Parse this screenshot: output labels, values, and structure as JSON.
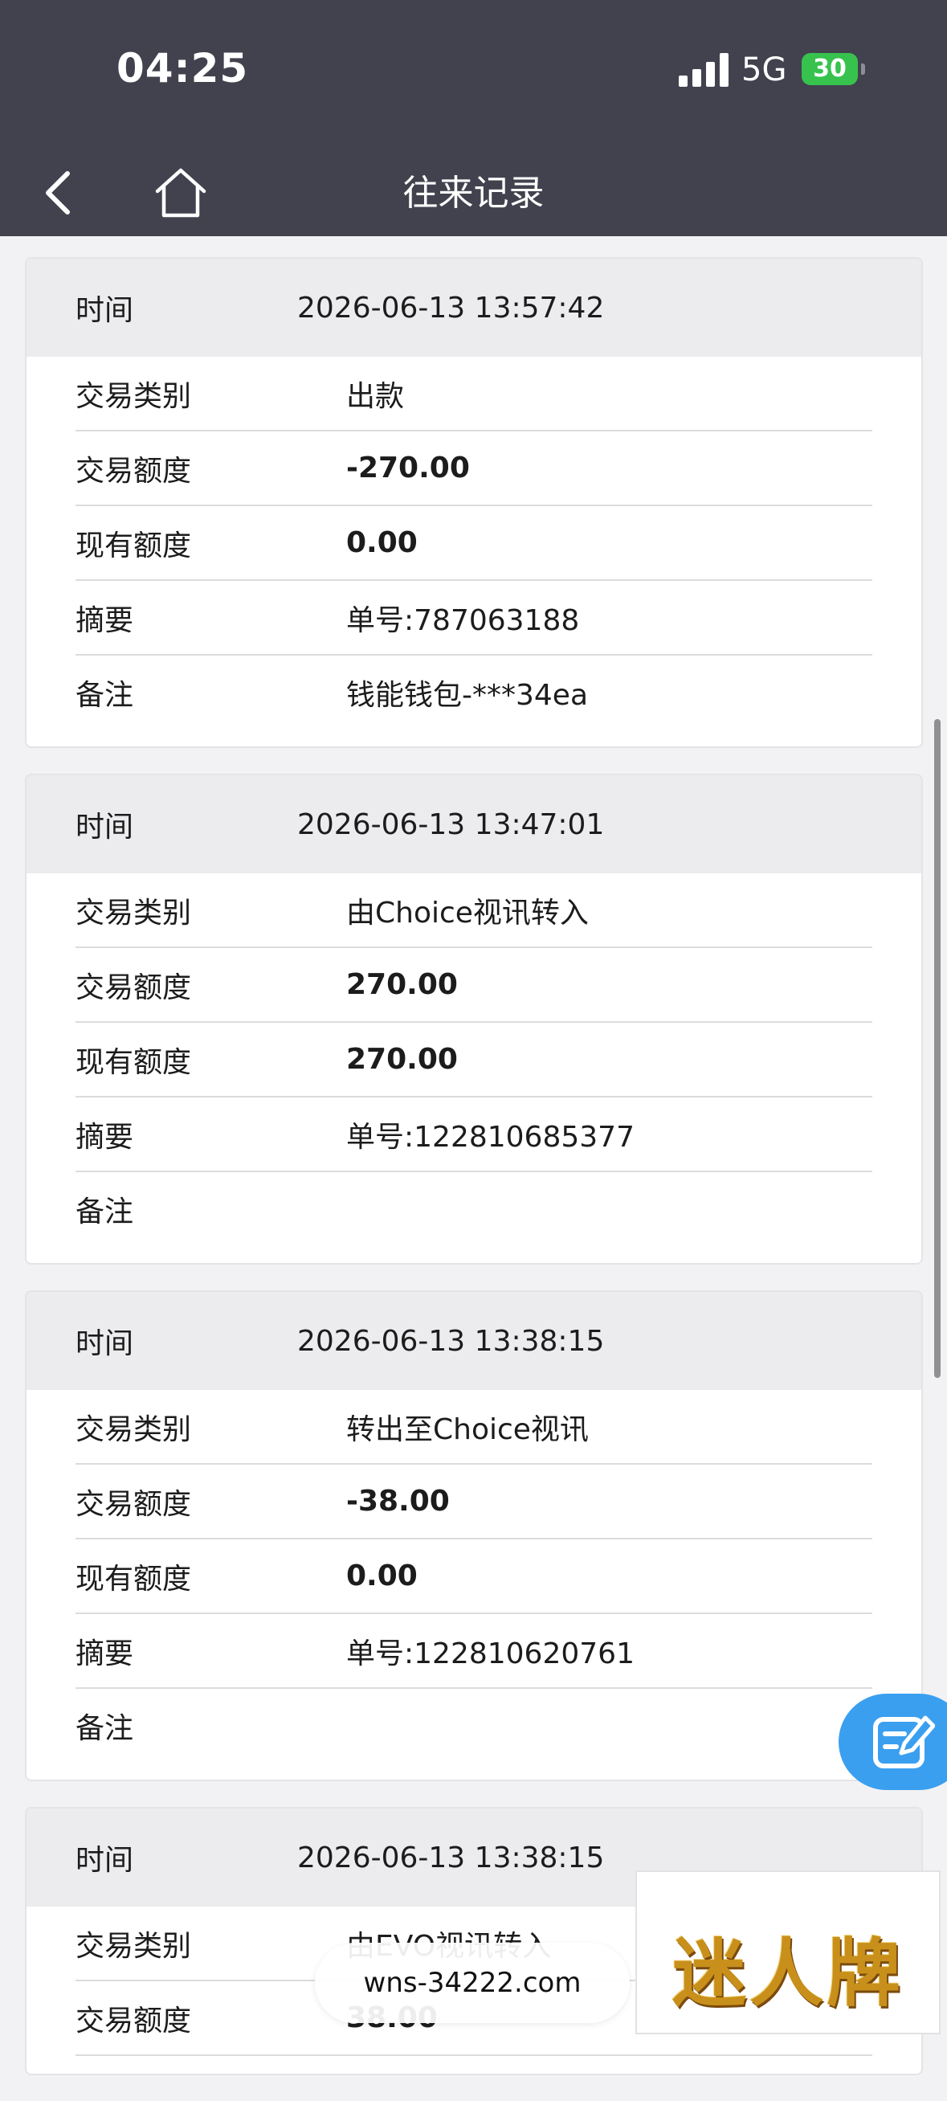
{
  "status_bar": {
    "time": "04:25",
    "network": "5G",
    "battery": "30"
  },
  "nav": {
    "back_icon": "chevron-left-icon",
    "home_icon": "home-icon",
    "title": "往来记录"
  },
  "labels": {
    "time": "时间",
    "type": "交易类别",
    "amount": "交易额度",
    "balance": "现有额度",
    "summary": "摘要",
    "note": "备注"
  },
  "records": [
    {
      "time": "2026-06-13 13:57:42",
      "type": "出款",
      "amount": "-270.00",
      "balance": "0.00",
      "summary": "单号:787063188",
      "note": "钱能钱包-***34ea"
    },
    {
      "time": "2026-06-13 13:47:01",
      "type": "由Choice视讯转入",
      "amount": "270.00",
      "balance": "270.00",
      "summary": "单号:122810685377",
      "note": ""
    },
    {
      "time": "2026-06-13 13:38:15",
      "type": "转出至Choice视讯",
      "amount": "-38.00",
      "balance": "0.00",
      "summary": "单号:122810620761",
      "note": ""
    },
    {
      "time": "2026-06-13 13:38:15",
      "type": "由EVO视讯转入",
      "amount": "38.00"
    }
  ],
  "overlay": {
    "url": "wns-34222.com",
    "logo_text": "迷人牌",
    "edit_icon": "edit-icon"
  },
  "colors": {
    "header_bg": "#42424f",
    "fab_bg": "#3b9ff0",
    "battery": "#37c24e"
  }
}
